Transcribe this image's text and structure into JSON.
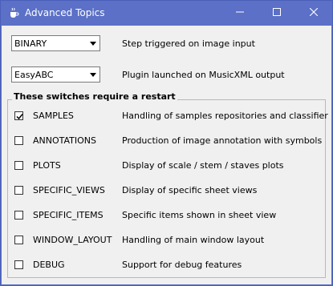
{
  "window": {
    "title": "Advanced Topics",
    "minimize_icon": "minimize-icon",
    "maximize_icon": "maximize-icon",
    "close_icon": "close-icon",
    "app_icon": "java-cup-icon"
  },
  "combos": [
    {
      "value": "BINARY",
      "description": "Step triggered on image input"
    },
    {
      "value": "EasyABC",
      "description": "Plugin launched on MusicXML output"
    }
  ],
  "switches": {
    "title": "These switches require a restart",
    "items": [
      {
        "name": "SAMPLES",
        "checked": true,
        "description": "Handling of samples repositories and classifier"
      },
      {
        "name": "ANNOTATIONS",
        "checked": false,
        "description": "Production of image annotation with symbols"
      },
      {
        "name": "PLOTS",
        "checked": false,
        "description": "Display of scale / stem / staves plots"
      },
      {
        "name": "SPECIFIC_VIEWS",
        "checked": false,
        "description": "Display of specific sheet views"
      },
      {
        "name": "SPECIFIC_ITEMS",
        "checked": false,
        "description": "Specific items shown in sheet view"
      },
      {
        "name": "WINDOW_LAYOUT",
        "checked": false,
        "description": "Handling of main window layout"
      },
      {
        "name": "DEBUG",
        "checked": false,
        "description": "Support for debug features"
      }
    ]
  },
  "colors": {
    "titlebar": "#5b70c6",
    "client": "#f0f0f0"
  }
}
